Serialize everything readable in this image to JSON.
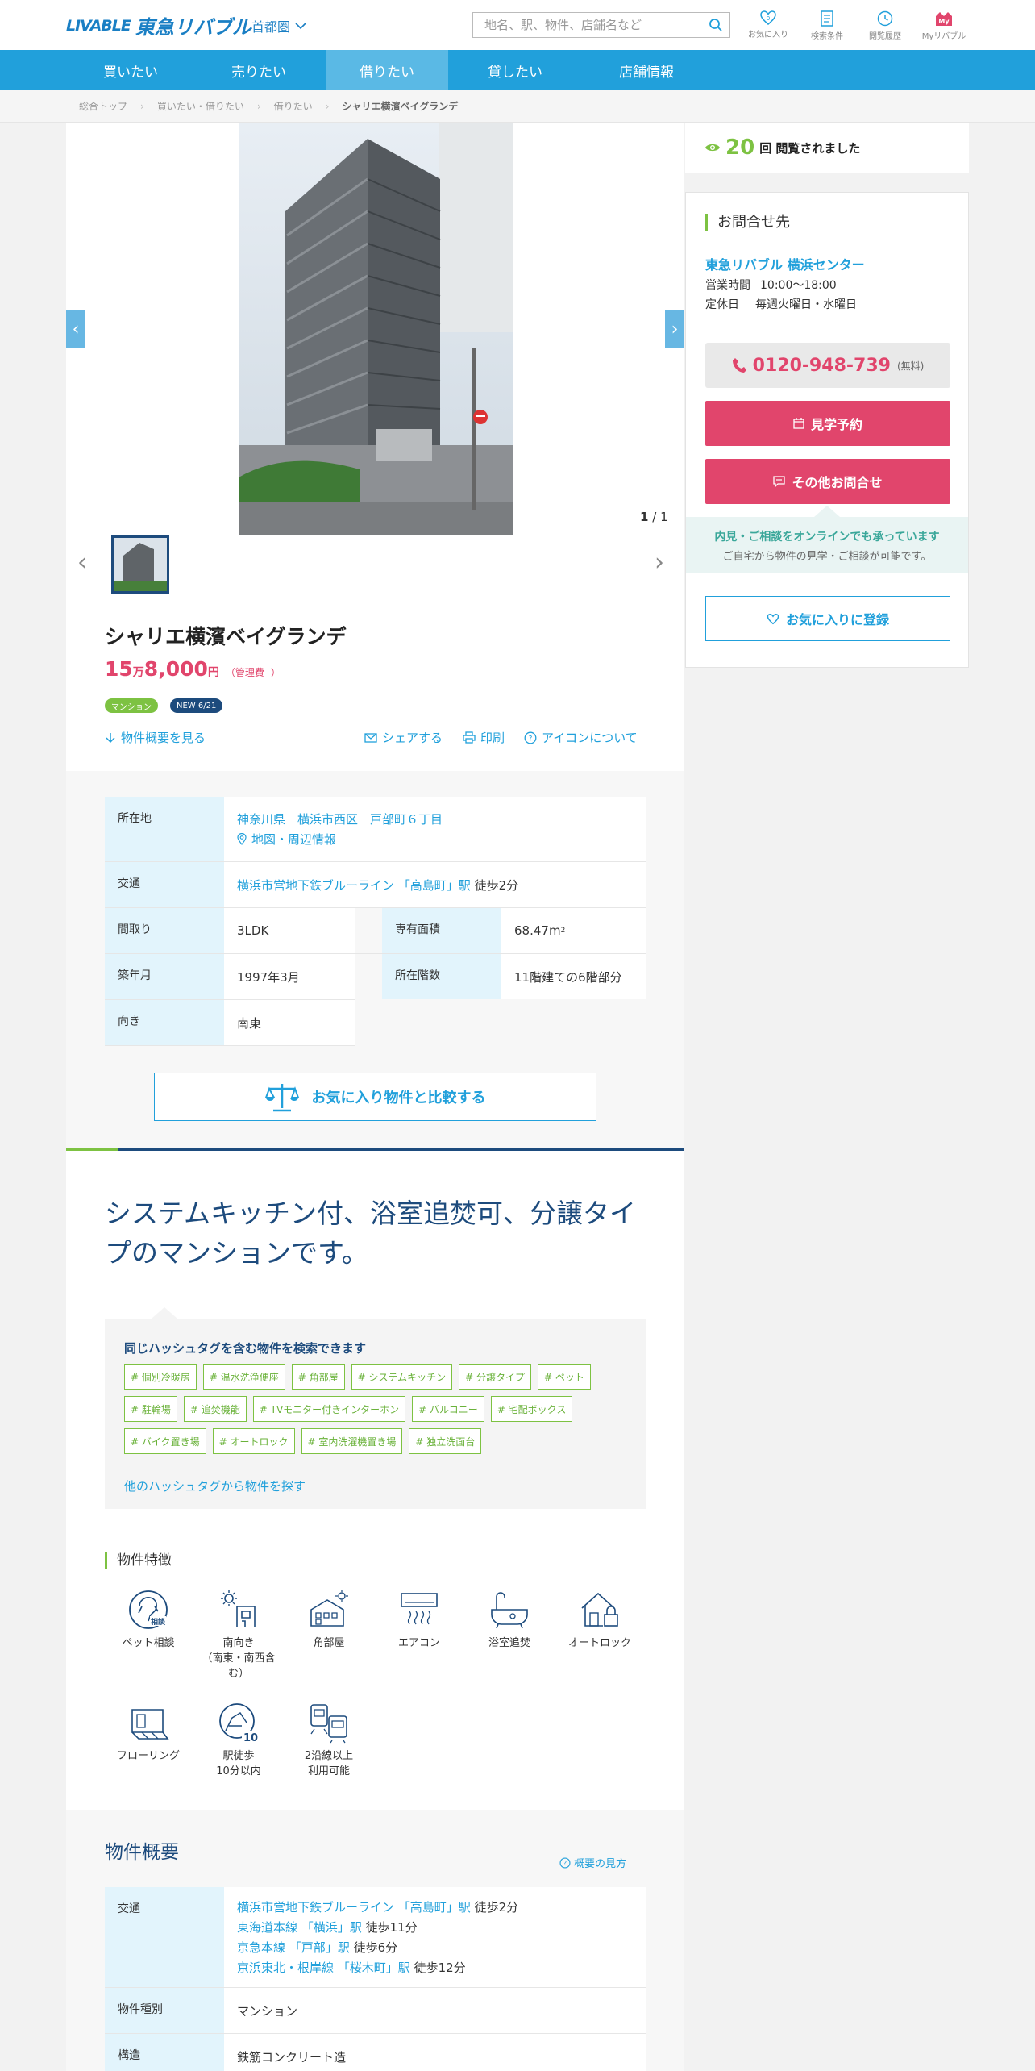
{
  "header": {
    "logo_mark": "LIVABLE",
    "logo_text": "東急リバブル",
    "region": "首都圏",
    "search_placeholder": "地名、駅、物件、店舗名など",
    "nav": [
      {
        "label": "お気に入り",
        "icon": "heart-icon"
      },
      {
        "label": "検索条件",
        "icon": "document-icon"
      },
      {
        "label": "閲覧履歴",
        "icon": "clock-icon"
      },
      {
        "label": "Myリバブル",
        "icon": "my-icon"
      }
    ]
  },
  "mainnav": [
    "買いたい",
    "売りたい",
    "借りたい",
    "貸したい",
    "店舗情報"
  ],
  "mainnav_active": "借りたい",
  "breadcrumb": [
    "総合トップ",
    "買いたい・借りたい",
    "借りたい",
    "シャリエ横濱ベイグランデ"
  ],
  "gallery": {
    "current": "1",
    "sep": "/",
    "total": "1"
  },
  "property": {
    "name": "シャリエ横濱ベイグランデ",
    "price_man": "15",
    "man": "万",
    "price_rest": "8,000",
    "yen": "円",
    "fee": "（管理費 -）",
    "badges": [
      {
        "label": "マンション",
        "color": "#7dc242"
      },
      {
        "label": "NEW 6/21",
        "color": "#1d4b7d"
      }
    ]
  },
  "actions": {
    "overview": "物件概要を見る",
    "share": "シェアする",
    "print": "印刷",
    "icons": "アイコンについて"
  },
  "info": {
    "location_label": "所在地",
    "location": "神奈川県　横浜市西区　戸部町６丁目",
    "map_link": "地図・周辺情報",
    "traffic_label": "交通",
    "traffic_line": "横浜市営地下鉄ブルーライン 「高島町」駅",
    "traffic_walk": "徒歩2分",
    "layout_label": "間取り",
    "layout": "3LDK",
    "area_label": "専有面積",
    "area": "68.47m",
    "area_sup": "2",
    "built_label": "築年月",
    "built": "1997年3月",
    "floor_label": "所在階数",
    "floor": "11階建ての6階部分",
    "dir_label": "向き",
    "dir": "南東"
  },
  "compare_label": "お気に入り物件と比較する",
  "catch_copy": "システムキッチン付、浴室追焚可、分譲タイプのマンションです。",
  "hashtags": {
    "heading": "同じハッシュタグを含む物件を検索できます",
    "tags": [
      "# 個別冷暖房",
      "# 温水洗浄便座",
      "# 角部屋",
      "# システムキッチン",
      "# 分譲タイプ",
      "# ペット",
      "# 駐輪場",
      "# 追焚機能",
      "# TVモニター付きインターホン",
      "# バルコニー",
      "# 宅配ボックス",
      "# バイク置き場",
      "# オートロック",
      "# 室内洗濯機置き場",
      "# 独立洗面台"
    ],
    "more": "他のハッシュタグから物件を探す"
  },
  "features": {
    "title": "物件特徴",
    "items": [
      {
        "label": "ペット相談",
        "icon": "pet-icon",
        "badge": "相談"
      },
      {
        "label": "南向き\n（南東・南西含む）",
        "icon": "south-facing-icon"
      },
      {
        "label": "角部屋",
        "icon": "corner-room-icon"
      },
      {
        "label": "エアコン",
        "icon": "air-conditioner-icon"
      },
      {
        "label": "浴室追焚",
        "icon": "bath-reheat-icon"
      },
      {
        "label": "オートロック",
        "icon": "autolock-icon"
      },
      {
        "label": "フローリング",
        "icon": "flooring-icon"
      },
      {
        "label": "駅徒歩\n10分以内",
        "icon": "walk-station-icon",
        "badge": "10"
      },
      {
        "label": "2沿線以上\n利用可能",
        "icon": "multi-line-icon"
      }
    ]
  },
  "outline": {
    "title": "物件概要",
    "help": "概要の見方",
    "traffic_label": "交通",
    "traffic": [
      {
        "line": "横浜市営地下鉄ブルーライン 「高島町」駅",
        "walk": "徒歩2分"
      },
      {
        "line": "東海道本線 「横浜」駅",
        "walk": "徒歩11分"
      },
      {
        "line": "京急本線 「戸部」駅",
        "walk": "徒歩6分"
      },
      {
        "line": "京浜東北・根岸線 「桜木町」駅",
        "walk": "徒歩12分"
      }
    ],
    "type_label": "物件種別",
    "type": "マンション",
    "structure_label": "構造",
    "structure": "鉄筋コンクリート造"
  },
  "sidebar": {
    "views": "20",
    "views_text": "回 閲覧されました",
    "contact_title": "お問合せ先",
    "store": "東急リバブル 横浜センター",
    "hours_label": "営業時間",
    "hours": "10:00～18:00",
    "holiday_label": "定休日",
    "holiday": "毎週火曜日・水曜日",
    "tel": "0120-948-739",
    "tel_note": "(無料)",
    "visit": "見学予約",
    "other": "その他お問合せ",
    "online1": "内見・ご相談をオンラインでも承っています",
    "online2": "ご自宅から物件の見学・ご相談が可能です。",
    "favorite": "お気に入りに登録"
  },
  "colors": {
    "accent": "#21a0db",
    "pink": "#e1456c",
    "green": "#7dc242",
    "navy": "#1d4b7d"
  }
}
